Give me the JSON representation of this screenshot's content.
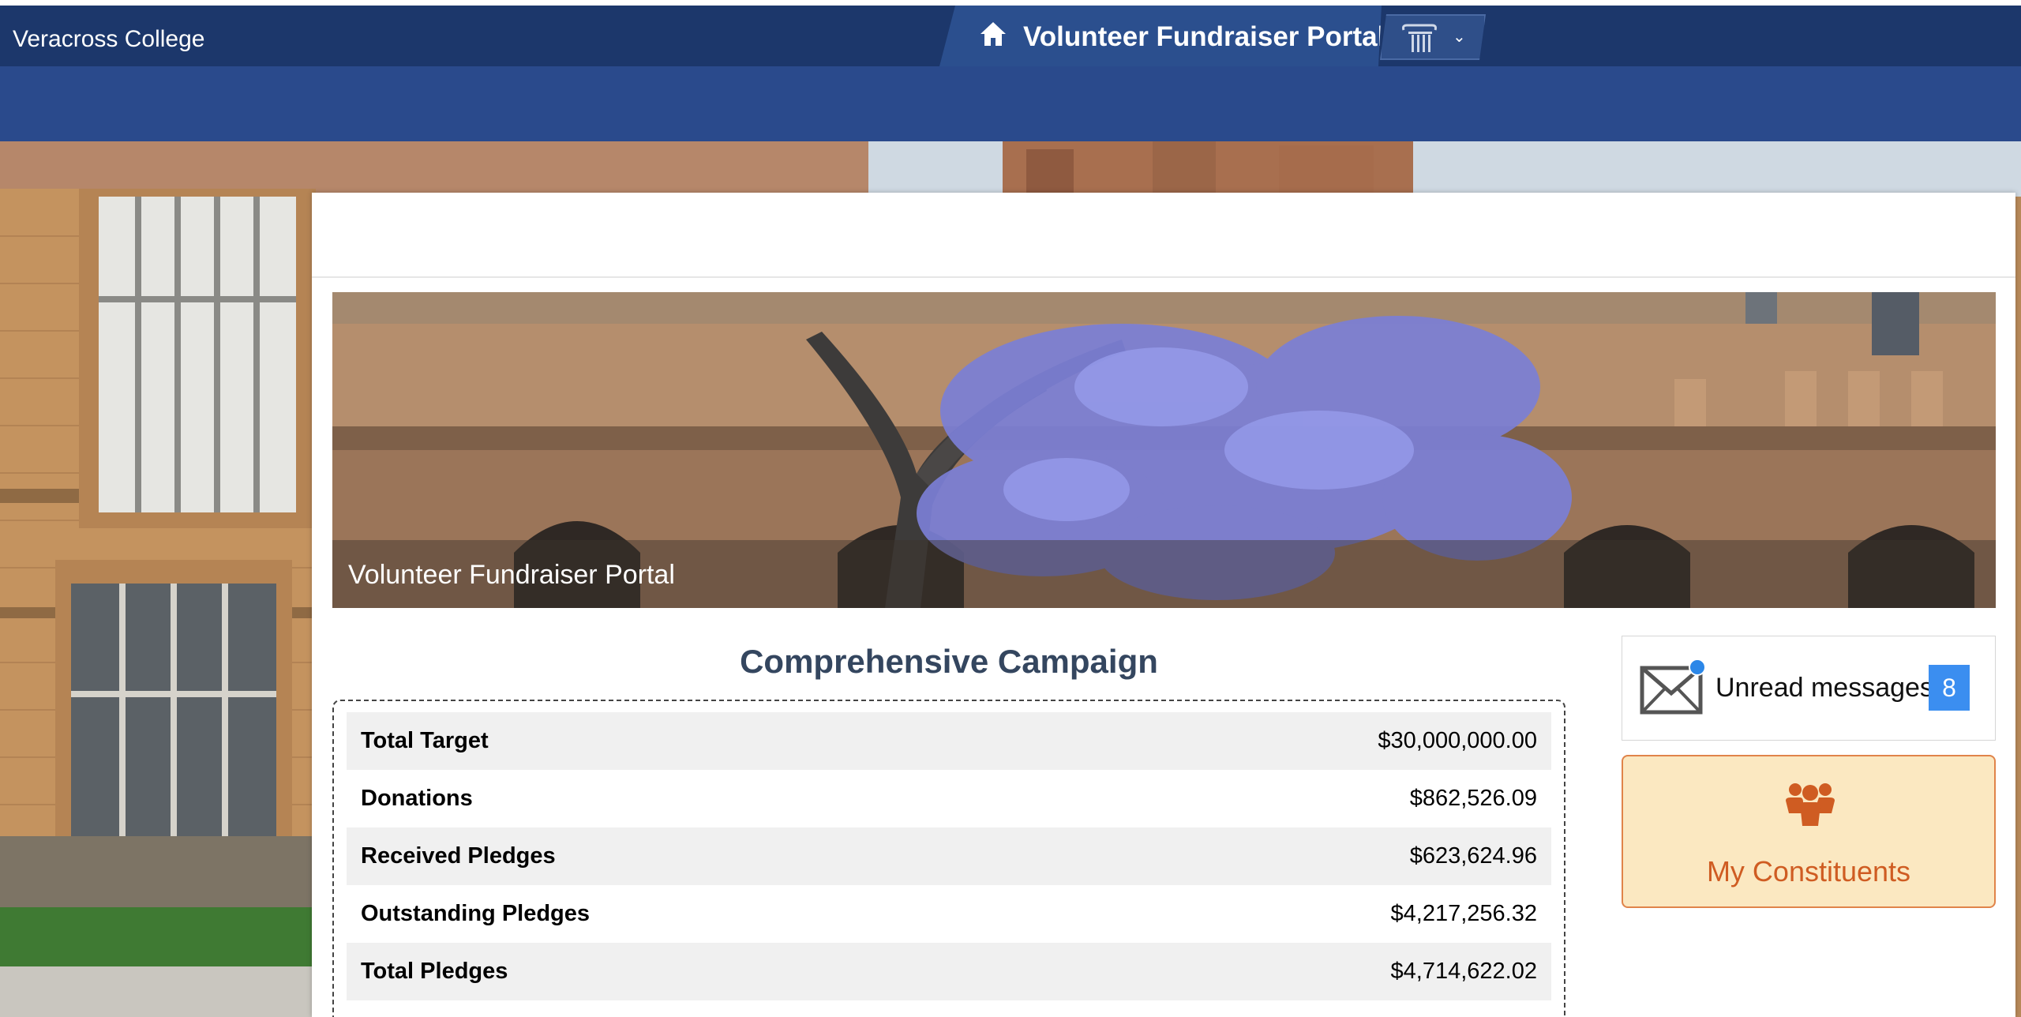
{
  "header": {
    "org_name": "Veracross College",
    "portal_title": "Volunteer Fundraiser Portal"
  },
  "hero": {
    "caption": "Volunteer Fundraiser Portal"
  },
  "campaign": {
    "title": "Comprehensive Campaign",
    "rows": [
      {
        "label": "Total Target",
        "value": "$30,000,000.00"
      },
      {
        "label": "Donations",
        "value": "$862,526.09"
      },
      {
        "label": "Received Pledges",
        "value": "$623,624.96"
      },
      {
        "label": "Outstanding Pledges",
        "value": "$4,217,256.32"
      },
      {
        "label": "Total Pledges",
        "value": "$4,714,622.02"
      }
    ]
  },
  "messages": {
    "label": "Unread messages",
    "count": "8"
  },
  "constituents": {
    "label": "My Constituents"
  },
  "colors": {
    "header_bg": "#1c376b",
    "nav_band": "#2a4a8c",
    "badge_blue": "#3b8ef0",
    "constituents_bg": "#fbe8c1",
    "constituents_accent": "#cf5c22"
  },
  "icons": [
    "home-icon",
    "institution-column-icon",
    "chevron-down-icon",
    "envelope-icon",
    "people-icon"
  ]
}
